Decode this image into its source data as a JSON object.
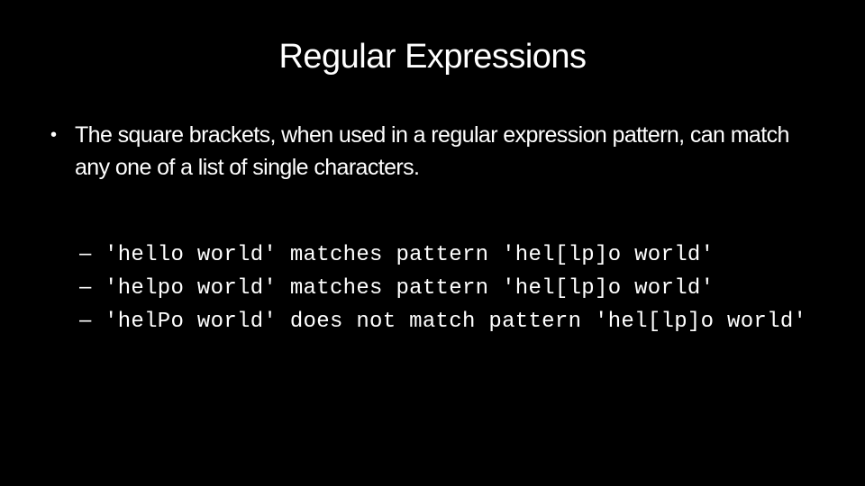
{
  "slide": {
    "title": "Regular Expressions",
    "bullet": {
      "marker": "•",
      "text": "The square brackets, when used in a regular expression pattern, can match any one of a list of single characters."
    },
    "sub_items": [
      {
        "marker": "–",
        "text": "'hello world' matches pattern 'hel[lp]o world'"
      },
      {
        "marker": "–",
        "text": "'helpo world' matches pattern 'hel[lp]o world'"
      },
      {
        "marker": "–",
        "text": "'helPo world' does not match pattern 'hel[lp]o world'"
      }
    ]
  }
}
